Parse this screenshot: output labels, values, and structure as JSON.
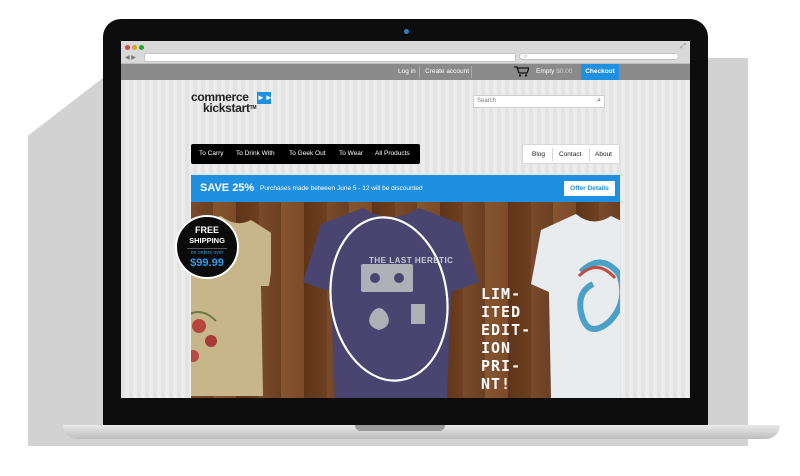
{
  "browser": {
    "url": "",
    "search_placeholder": ""
  },
  "topbar": {
    "login": "Log in",
    "create_account": "Create account",
    "cart_label": "Empty",
    "cart_amount": "$0.00",
    "checkout": "Checkout"
  },
  "logo": {
    "line1": "commerce",
    "line2": "kickstart",
    "tm": "TM"
  },
  "search": {
    "placeholder": "Search"
  },
  "category_nav": [
    "To Carry",
    "To Drink With",
    "To Geek Out",
    "To Wear",
    "All Products"
  ],
  "page_nav": [
    "Blog",
    "Contact",
    "About"
  ],
  "promo": {
    "headline": "SAVE 25%",
    "text": "Purchases made between June 5 - 12 will be discounted",
    "button": "Offer Details"
  },
  "badge": {
    "free": "FREE",
    "shipping": "SHIPPING",
    "orders_over": "on orders over",
    "amount": "$99.99"
  },
  "hero": {
    "shirt_text": "THE LAST HERETIC",
    "limited": [
      "LIM-",
      "ITED",
      "EDIT-",
      "ION",
      "PRI-",
      "NT!"
    ]
  },
  "colors": {
    "accent": "#1f8fe0",
    "topbar": "#8a8a8a",
    "nav_bg": "#000000"
  }
}
